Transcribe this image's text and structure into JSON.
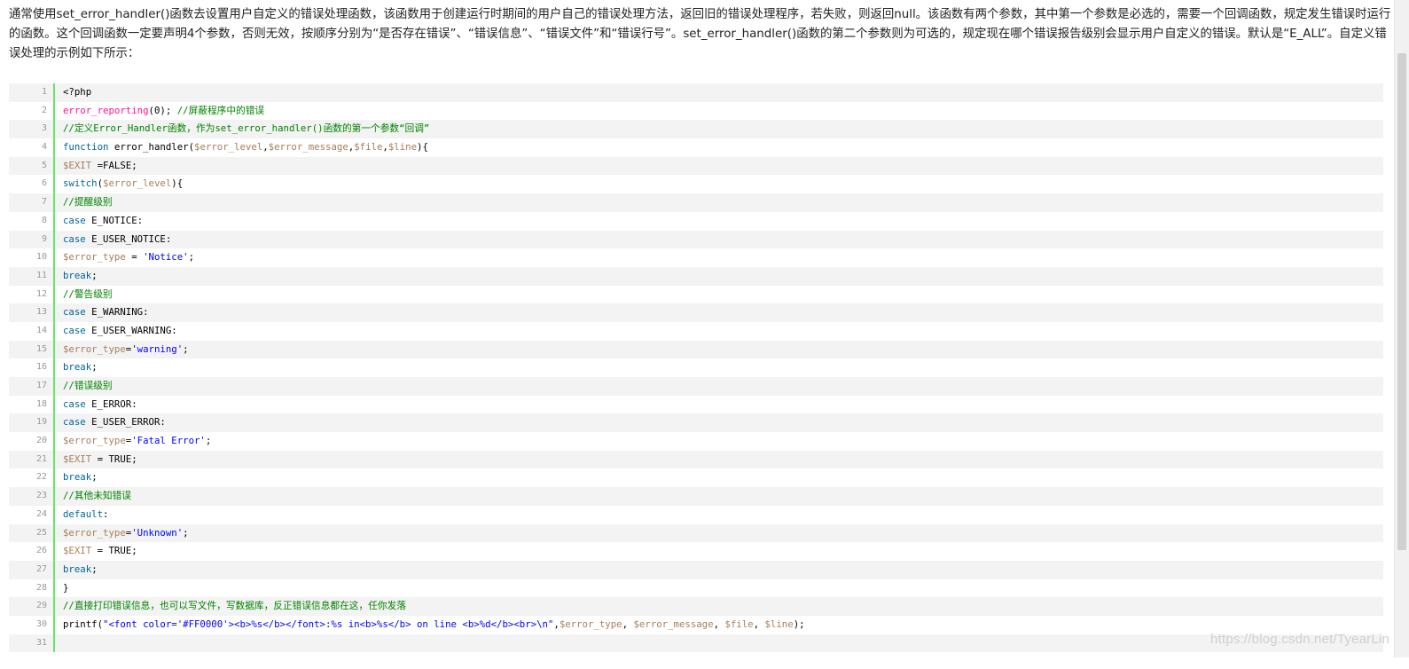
{
  "article": {
    "paragraph": "通常使用set_error_handler()函数去设置用户自定义的错误处理函数，该函数用于创建运行时期间的用户自己的错误处理方法，返回旧的错误处理程序，若失败，则返回null。该函数有两个参数，其中第一个参数是必选的，需要一个回调函数，规定发生错误时运行的函数。这个回调函数一定要声明4个参数，否则无效，按顺序分别为“是否存在错误”、“错误信息”、“错误文件”和“错误行号”。set_error_handler()函数的第二个参数则为可选的，规定现在哪个错误报告级别会显示用户自定义的错误。默认是“E_ALL”。自定义错误处理的示例如下所示："
  },
  "code": {
    "lines": [
      {
        "num": "1",
        "tokens": [
          {
            "t": "<?php",
            "c": "plain"
          }
        ]
      },
      {
        "num": "2",
        "tokens": [
          {
            "t": "error_reporting",
            "c": "func"
          },
          {
            "t": "(0); ",
            "c": "plain"
          },
          {
            "t": "//屏蔽程序中的错误",
            "c": "comment"
          }
        ]
      },
      {
        "num": "3",
        "tokens": [
          {
            "t": "//定义Error_Handler函数，作为set_error_handler()函数的第一个参数“回调”",
            "c": "comment"
          }
        ]
      },
      {
        "num": "4",
        "tokens": [
          {
            "t": "function",
            "c": "keyword"
          },
          {
            "t": " error_handler(",
            "c": "plain"
          },
          {
            "t": "$error_level",
            "c": "var"
          },
          {
            "t": ",",
            "c": "plain"
          },
          {
            "t": "$error_message",
            "c": "var"
          },
          {
            "t": ",",
            "c": "plain"
          },
          {
            "t": "$file",
            "c": "var"
          },
          {
            "t": ",",
            "c": "plain"
          },
          {
            "t": "$line",
            "c": "var"
          },
          {
            "t": "){",
            "c": "plain"
          }
        ]
      },
      {
        "num": "5",
        "tokens": [
          {
            "t": "$EXIT",
            "c": "var"
          },
          {
            "t": " =FALSE;",
            "c": "plain"
          }
        ]
      },
      {
        "num": "6",
        "tokens": [
          {
            "t": "switch",
            "c": "keyword"
          },
          {
            "t": "(",
            "c": "plain"
          },
          {
            "t": "$error_level",
            "c": "var"
          },
          {
            "t": "){",
            "c": "plain"
          }
        ]
      },
      {
        "num": "7",
        "tokens": [
          {
            "t": "//提醒级别",
            "c": "comment"
          }
        ]
      },
      {
        "num": "8",
        "tokens": [
          {
            "t": "case",
            "c": "keyword"
          },
          {
            "t": " E_NOTICE:",
            "c": "plain"
          }
        ]
      },
      {
        "num": "9",
        "tokens": [
          {
            "t": "case",
            "c": "keyword"
          },
          {
            "t": " E_USER_NOTICE:",
            "c": "plain"
          }
        ]
      },
      {
        "num": "10",
        "tokens": [
          {
            "t": "$error_type",
            "c": "var"
          },
          {
            "t": " = ",
            "c": "plain"
          },
          {
            "t": "'Notice'",
            "c": "string"
          },
          {
            "t": ";",
            "c": "plain"
          }
        ]
      },
      {
        "num": "11",
        "tokens": [
          {
            "t": "break",
            "c": "keyword"
          },
          {
            "t": ";",
            "c": "plain"
          }
        ]
      },
      {
        "num": "12",
        "tokens": [
          {
            "t": "//警告级别",
            "c": "comment"
          }
        ]
      },
      {
        "num": "13",
        "tokens": [
          {
            "t": "case",
            "c": "keyword"
          },
          {
            "t": " E_WARNING:",
            "c": "plain"
          }
        ]
      },
      {
        "num": "14",
        "tokens": [
          {
            "t": "case",
            "c": "keyword"
          },
          {
            "t": " E_USER_WARNING:",
            "c": "plain"
          }
        ]
      },
      {
        "num": "15",
        "tokens": [
          {
            "t": "$error_type",
            "c": "var"
          },
          {
            "t": "=",
            "c": "plain"
          },
          {
            "t": "'warning'",
            "c": "string"
          },
          {
            "t": ";",
            "c": "plain"
          }
        ]
      },
      {
        "num": "16",
        "tokens": [
          {
            "t": "break",
            "c": "keyword"
          },
          {
            "t": ";",
            "c": "plain"
          }
        ]
      },
      {
        "num": "17",
        "tokens": [
          {
            "t": "//错误级别",
            "c": "comment"
          }
        ]
      },
      {
        "num": "18",
        "tokens": [
          {
            "t": "case",
            "c": "keyword"
          },
          {
            "t": " E_ERROR:",
            "c": "plain"
          }
        ]
      },
      {
        "num": "19",
        "tokens": [
          {
            "t": "case",
            "c": "keyword"
          },
          {
            "t": " E_USER_ERROR:",
            "c": "plain"
          }
        ]
      },
      {
        "num": "20",
        "tokens": [
          {
            "t": "$error_type",
            "c": "var"
          },
          {
            "t": "=",
            "c": "plain"
          },
          {
            "t": "'Fatal Error'",
            "c": "string"
          },
          {
            "t": ";",
            "c": "plain"
          }
        ]
      },
      {
        "num": "21",
        "tokens": [
          {
            "t": "$EXIT",
            "c": "var"
          },
          {
            "t": " = TRUE;",
            "c": "plain"
          }
        ]
      },
      {
        "num": "22",
        "tokens": [
          {
            "t": "break",
            "c": "keyword"
          },
          {
            "t": ";",
            "c": "plain"
          }
        ]
      },
      {
        "num": "23",
        "tokens": [
          {
            "t": "//其他未知错误",
            "c": "comment"
          }
        ]
      },
      {
        "num": "24",
        "tokens": [
          {
            "t": "default",
            "c": "keyword"
          },
          {
            "t": ":",
            "c": "plain"
          }
        ]
      },
      {
        "num": "25",
        "tokens": [
          {
            "t": "$error_type",
            "c": "var"
          },
          {
            "t": "=",
            "c": "plain"
          },
          {
            "t": "'Unknown'",
            "c": "string"
          },
          {
            "t": ";",
            "c": "plain"
          }
        ]
      },
      {
        "num": "26",
        "tokens": [
          {
            "t": "$EXIT",
            "c": "var"
          },
          {
            "t": " = TRUE;",
            "c": "plain"
          }
        ]
      },
      {
        "num": "27",
        "tokens": [
          {
            "t": "break",
            "c": "keyword"
          },
          {
            "t": ";",
            "c": "plain"
          }
        ]
      },
      {
        "num": "28",
        "tokens": [
          {
            "t": "}",
            "c": "plain"
          }
        ]
      },
      {
        "num": "29",
        "tokens": [
          {
            "t": "//直接打印错误信息，也可以写文件，写数据库，反正错误信息都在这，任你发落",
            "c": "comment"
          }
        ]
      },
      {
        "num": "30",
        "tokens": [
          {
            "t": "printf(",
            "c": "plain"
          },
          {
            "t": "\"<font color='#FF0000'><b>%s</b></font>:%s in<b>%s</b> on line <b>%d</b><br>\\n\"",
            "c": "string"
          },
          {
            "t": ",",
            "c": "plain"
          },
          {
            "t": "$error_type",
            "c": "var"
          },
          {
            "t": ", ",
            "c": "plain"
          },
          {
            "t": "$error_message",
            "c": "var"
          },
          {
            "t": ", ",
            "c": "plain"
          },
          {
            "t": "$file",
            "c": "var"
          },
          {
            "t": ", ",
            "c": "plain"
          },
          {
            "t": "$line",
            "c": "var"
          },
          {
            "t": ");",
            "c": "plain"
          }
        ]
      },
      {
        "num": "31",
        "tokens": []
      }
    ]
  },
  "watermark": "https://blog.csdn.net/TyearLin",
  "colors": {
    "gutter_bar": "#6ce26c",
    "comment": "#008200",
    "keyword": "#006699",
    "string": "#0000ff",
    "variable": "#a67f59",
    "function": "#ff1493",
    "odd_row": "#f3f3f3"
  }
}
